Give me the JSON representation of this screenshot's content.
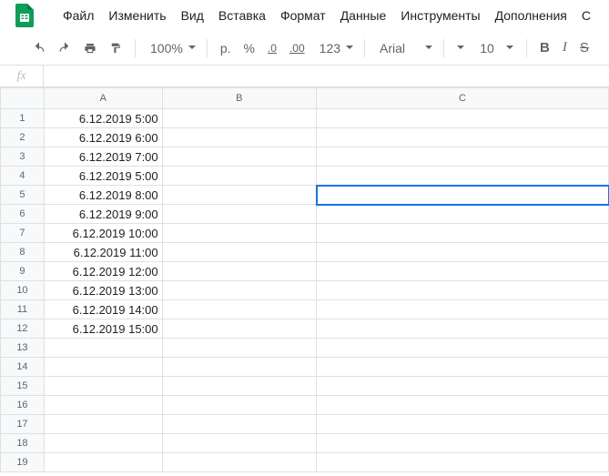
{
  "menubar": {
    "items": [
      "Файл",
      "Изменить",
      "Вид",
      "Вставка",
      "Формат",
      "Данные",
      "Инструменты",
      "Дополнения",
      "С"
    ]
  },
  "toolbar": {
    "zoom": "100%",
    "currency": "р.",
    "percent": "%",
    "dec_less": ".0",
    "dec_more": ".00",
    "num_format": "123",
    "font": "Arial",
    "font_size": "10",
    "bold": "B",
    "italic": "I",
    "strike": "S"
  },
  "fx": {
    "label": "fx",
    "value": ""
  },
  "columns": [
    "A",
    "B",
    "C"
  ],
  "rows": [
    {
      "n": "1",
      "A": "6.12.2019 5:00",
      "B": "",
      "C": ""
    },
    {
      "n": "2",
      "A": "6.12.2019 6:00",
      "B": "",
      "C": ""
    },
    {
      "n": "3",
      "A": "6.12.2019 7:00",
      "B": "",
      "C": ""
    },
    {
      "n": "4",
      "A": "6.12.2019 5:00",
      "B": "",
      "C": ""
    },
    {
      "n": "5",
      "A": "6.12.2019 8:00",
      "B": "",
      "C": ""
    },
    {
      "n": "6",
      "A": "6.12.2019 9:00",
      "B": "",
      "C": ""
    },
    {
      "n": "7",
      "A": "6.12.2019 10:00",
      "B": "",
      "C": ""
    },
    {
      "n": "8",
      "A": "6.12.2019 11:00",
      "B": "",
      "C": ""
    },
    {
      "n": "9",
      "A": "6.12.2019 12:00",
      "B": "",
      "C": ""
    },
    {
      "n": "10",
      "A": "6.12.2019 13:00",
      "B": "",
      "C": ""
    },
    {
      "n": "11",
      "A": "6.12.2019 14:00",
      "B": "",
      "C": ""
    },
    {
      "n": "12",
      "A": "6.12.2019 15:00",
      "B": "",
      "C": ""
    },
    {
      "n": "13",
      "A": "",
      "B": "",
      "C": ""
    },
    {
      "n": "14",
      "A": "",
      "B": "",
      "C": ""
    },
    {
      "n": "15",
      "A": "",
      "B": "",
      "C": ""
    },
    {
      "n": "16",
      "A": "",
      "B": "",
      "C": ""
    },
    {
      "n": "17",
      "A": "",
      "B": "",
      "C": ""
    },
    {
      "n": "18",
      "A": "",
      "B": "",
      "C": ""
    },
    {
      "n": "19",
      "A": "",
      "B": "",
      "C": ""
    }
  ],
  "selected": {
    "row": 5,
    "col": "C"
  }
}
